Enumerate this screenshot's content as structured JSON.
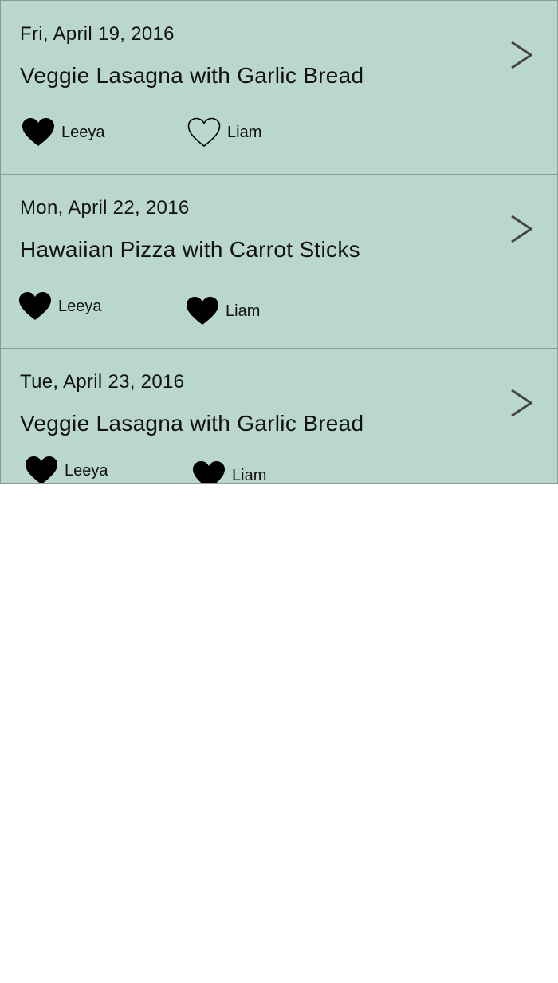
{
  "meals": [
    {
      "date": "Fri, April 19, 2016",
      "title": "Veggie Lasagna with Garlic Bread",
      "votes": [
        {
          "name": "Leeya",
          "liked": true,
          "icon": "heart-filled-icon"
        },
        {
          "name": "Liam",
          "liked": false,
          "icon": "heart-outline-icon"
        }
      ],
      "chevron_icon": "chevron-right-icon"
    },
    {
      "date": "Mon, April 22, 2016",
      "title": "Hawaiian Pizza with Carrot Sticks",
      "votes": [
        {
          "name": "Leeya",
          "liked": true,
          "icon": "heart-filled-icon"
        },
        {
          "name": "Liam",
          "liked": true,
          "icon": "heart-filled-icon"
        }
      ],
      "chevron_icon": "chevron-right-icon"
    },
    {
      "date": "Tue, April 23, 2016",
      "title": "Veggie Lasagna with Garlic Bread",
      "votes": [
        {
          "name": "Leeya",
          "liked": true,
          "icon": "heart-filled-icon"
        },
        {
          "name": "Liam",
          "liked": true,
          "icon": "heart-filled-icon"
        }
      ],
      "chevron_icon": "chevron-right-icon"
    }
  ],
  "colors": {
    "row_background": "#bad7cf",
    "row_border": "#8a9a96",
    "text": "#111111",
    "chevron": "#444444",
    "page_background": "#ffffff"
  }
}
